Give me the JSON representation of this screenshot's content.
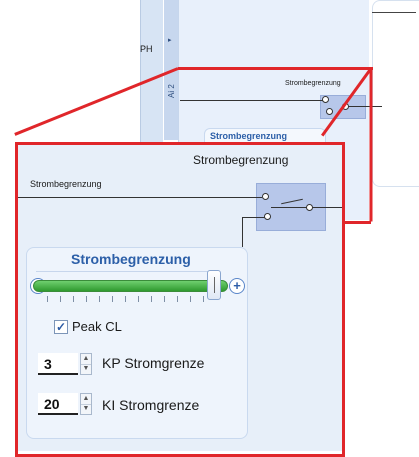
{
  "background": {
    "side_label": "PH",
    "vertical_tab": "Ai 2",
    "small_limit_label": "Strombegrenzung",
    "small_panel_title": "Strombegrenzung"
  },
  "zoom": {
    "header_right_label": "Strombegrenzung",
    "line_label": "Strombegrenzung",
    "panel": {
      "title": "Strombegrenzung",
      "slider": {
        "minus_symbol": "−",
        "plus_symbol": "+",
        "value_fraction": 0.93
      },
      "peak_cl": {
        "label": "Peak CL",
        "checked": true
      },
      "kp": {
        "value": "3",
        "label": "KP Stromgrenze"
      },
      "ki": {
        "value": "20",
        "label": "KI Stromgrenze"
      }
    }
  },
  "colors": {
    "accent_red": "#e0262a",
    "title_blue": "#2c5fa8",
    "slider_green": "#3aa63a"
  }
}
